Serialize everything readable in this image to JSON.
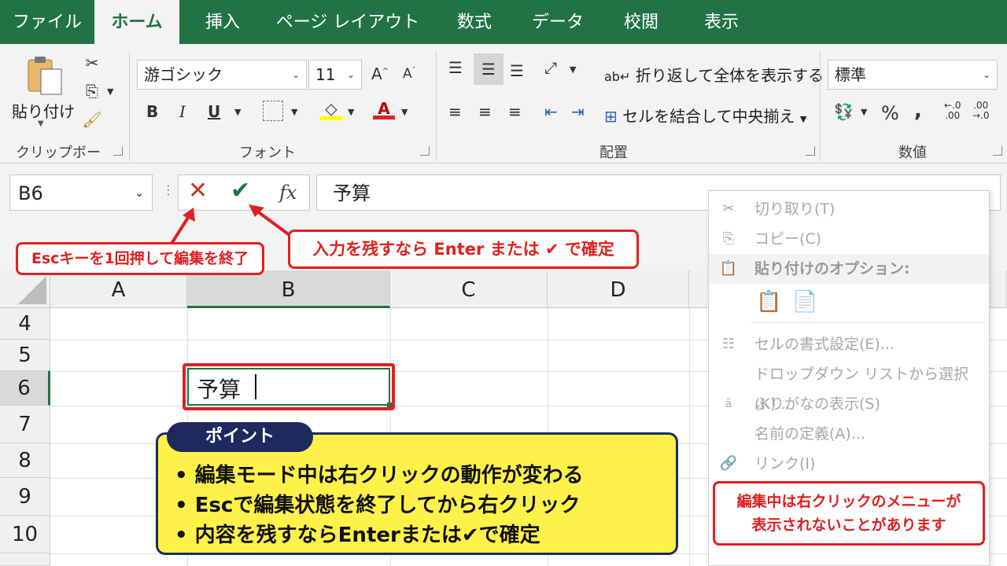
{
  "tabs": [
    "ファイル",
    "ホーム",
    "挿入",
    "ページ レイアウト",
    "数式",
    "データ",
    "校閲",
    "表示"
  ],
  "clipboard": {
    "paste_label": "貼り付け",
    "group_label": "クリップボード"
  },
  "font": {
    "name": "游ゴシック",
    "size": "11",
    "group_label": "フォント",
    "bold": "B",
    "italic": "I",
    "underline": "U"
  },
  "alignment": {
    "wrap_label": "折り返して全体を表示する",
    "merge_label": "セルを結合して中央揃え",
    "group_label": "配置"
  },
  "number": {
    "format": "標準",
    "group_label": "数値",
    "percent": "%",
    "comma": ","
  },
  "formula_bar": {
    "name_box": "B6",
    "fx": "fx",
    "content": "予算"
  },
  "columns": [
    "A",
    "B",
    "C",
    "D"
  ],
  "rows": [
    "4",
    "5",
    "6",
    "7",
    "8",
    "9",
    "10"
  ],
  "cell_b6": "予算",
  "callouts": {
    "esc": "Escキーを1回押して編集を終了",
    "enter": "入力を残すなら Enter または ✔ で確定",
    "menu_note_line1": "編集中は右クリックのメニューが",
    "menu_note_line2": "表示されないことがあります"
  },
  "context_menu": {
    "cut": "切り取り(T)",
    "copy": "コピー(C)",
    "paste_options": "貼り付けのオプション:",
    "format_cells": "セルの書式設定(E)...",
    "dropdown": "ドロップダウン リストから選択(K)...",
    "furigana": "ふりがなの表示(S)",
    "define_name": "名前の定義(A)...",
    "link": "リンク(I)"
  },
  "point": {
    "title": "ポイント",
    "lines": [
      "• 編集モード中は右クリックの動作が変わる",
      "• Escで編集状態を終了してから右クリック",
      "• 内容を残すならEnterまたは✔で確定"
    ]
  },
  "colors": {
    "excel_green": "#217346",
    "callout_red": "#e02020",
    "point_yellow": "#fff14a",
    "point_navy": "#1d2a5e"
  }
}
